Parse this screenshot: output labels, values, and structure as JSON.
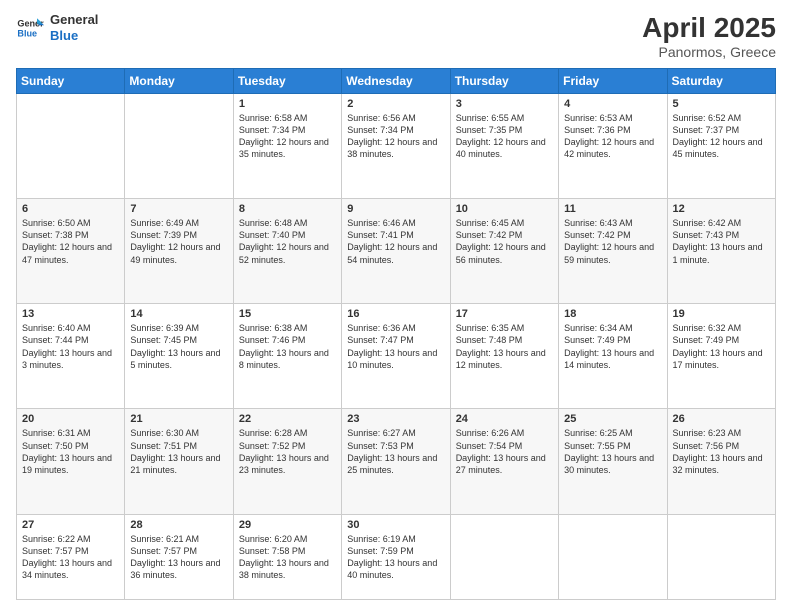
{
  "header": {
    "logo_line1": "General",
    "logo_line2": "Blue",
    "month_year": "April 2025",
    "location": "Panormos, Greece"
  },
  "weekdays": [
    "Sunday",
    "Monday",
    "Tuesday",
    "Wednesday",
    "Thursday",
    "Friday",
    "Saturday"
  ],
  "weeks": [
    [
      {
        "day": "",
        "sunrise": "",
        "sunset": "",
        "daylight": ""
      },
      {
        "day": "",
        "sunrise": "",
        "sunset": "",
        "daylight": ""
      },
      {
        "day": "1",
        "sunrise": "Sunrise: 6:58 AM",
        "sunset": "Sunset: 7:34 PM",
        "daylight": "Daylight: 12 hours and 35 minutes."
      },
      {
        "day": "2",
        "sunrise": "Sunrise: 6:56 AM",
        "sunset": "Sunset: 7:34 PM",
        "daylight": "Daylight: 12 hours and 38 minutes."
      },
      {
        "day": "3",
        "sunrise": "Sunrise: 6:55 AM",
        "sunset": "Sunset: 7:35 PM",
        "daylight": "Daylight: 12 hours and 40 minutes."
      },
      {
        "day": "4",
        "sunrise": "Sunrise: 6:53 AM",
        "sunset": "Sunset: 7:36 PM",
        "daylight": "Daylight: 12 hours and 42 minutes."
      },
      {
        "day": "5",
        "sunrise": "Sunrise: 6:52 AM",
        "sunset": "Sunset: 7:37 PM",
        "daylight": "Daylight: 12 hours and 45 minutes."
      }
    ],
    [
      {
        "day": "6",
        "sunrise": "Sunrise: 6:50 AM",
        "sunset": "Sunset: 7:38 PM",
        "daylight": "Daylight: 12 hours and 47 minutes."
      },
      {
        "day": "7",
        "sunrise": "Sunrise: 6:49 AM",
        "sunset": "Sunset: 7:39 PM",
        "daylight": "Daylight: 12 hours and 49 minutes."
      },
      {
        "day": "8",
        "sunrise": "Sunrise: 6:48 AM",
        "sunset": "Sunset: 7:40 PM",
        "daylight": "Daylight: 12 hours and 52 minutes."
      },
      {
        "day": "9",
        "sunrise": "Sunrise: 6:46 AM",
        "sunset": "Sunset: 7:41 PM",
        "daylight": "Daylight: 12 hours and 54 minutes."
      },
      {
        "day": "10",
        "sunrise": "Sunrise: 6:45 AM",
        "sunset": "Sunset: 7:42 PM",
        "daylight": "Daylight: 12 hours and 56 minutes."
      },
      {
        "day": "11",
        "sunrise": "Sunrise: 6:43 AM",
        "sunset": "Sunset: 7:42 PM",
        "daylight": "Daylight: 12 hours and 59 minutes."
      },
      {
        "day": "12",
        "sunrise": "Sunrise: 6:42 AM",
        "sunset": "Sunset: 7:43 PM",
        "daylight": "Daylight: 13 hours and 1 minute."
      }
    ],
    [
      {
        "day": "13",
        "sunrise": "Sunrise: 6:40 AM",
        "sunset": "Sunset: 7:44 PM",
        "daylight": "Daylight: 13 hours and 3 minutes."
      },
      {
        "day": "14",
        "sunrise": "Sunrise: 6:39 AM",
        "sunset": "Sunset: 7:45 PM",
        "daylight": "Daylight: 13 hours and 5 minutes."
      },
      {
        "day": "15",
        "sunrise": "Sunrise: 6:38 AM",
        "sunset": "Sunset: 7:46 PM",
        "daylight": "Daylight: 13 hours and 8 minutes."
      },
      {
        "day": "16",
        "sunrise": "Sunrise: 6:36 AM",
        "sunset": "Sunset: 7:47 PM",
        "daylight": "Daylight: 13 hours and 10 minutes."
      },
      {
        "day": "17",
        "sunrise": "Sunrise: 6:35 AM",
        "sunset": "Sunset: 7:48 PM",
        "daylight": "Daylight: 13 hours and 12 minutes."
      },
      {
        "day": "18",
        "sunrise": "Sunrise: 6:34 AM",
        "sunset": "Sunset: 7:49 PM",
        "daylight": "Daylight: 13 hours and 14 minutes."
      },
      {
        "day": "19",
        "sunrise": "Sunrise: 6:32 AM",
        "sunset": "Sunset: 7:49 PM",
        "daylight": "Daylight: 13 hours and 17 minutes."
      }
    ],
    [
      {
        "day": "20",
        "sunrise": "Sunrise: 6:31 AM",
        "sunset": "Sunset: 7:50 PM",
        "daylight": "Daylight: 13 hours and 19 minutes."
      },
      {
        "day": "21",
        "sunrise": "Sunrise: 6:30 AM",
        "sunset": "Sunset: 7:51 PM",
        "daylight": "Daylight: 13 hours and 21 minutes."
      },
      {
        "day": "22",
        "sunrise": "Sunrise: 6:28 AM",
        "sunset": "Sunset: 7:52 PM",
        "daylight": "Daylight: 13 hours and 23 minutes."
      },
      {
        "day": "23",
        "sunrise": "Sunrise: 6:27 AM",
        "sunset": "Sunset: 7:53 PM",
        "daylight": "Daylight: 13 hours and 25 minutes."
      },
      {
        "day": "24",
        "sunrise": "Sunrise: 6:26 AM",
        "sunset": "Sunset: 7:54 PM",
        "daylight": "Daylight: 13 hours and 27 minutes."
      },
      {
        "day": "25",
        "sunrise": "Sunrise: 6:25 AM",
        "sunset": "Sunset: 7:55 PM",
        "daylight": "Daylight: 13 hours and 30 minutes."
      },
      {
        "day": "26",
        "sunrise": "Sunrise: 6:23 AM",
        "sunset": "Sunset: 7:56 PM",
        "daylight": "Daylight: 13 hours and 32 minutes."
      }
    ],
    [
      {
        "day": "27",
        "sunrise": "Sunrise: 6:22 AM",
        "sunset": "Sunset: 7:57 PM",
        "daylight": "Daylight: 13 hours and 34 minutes."
      },
      {
        "day": "28",
        "sunrise": "Sunrise: 6:21 AM",
        "sunset": "Sunset: 7:57 PM",
        "daylight": "Daylight: 13 hours and 36 minutes."
      },
      {
        "day": "29",
        "sunrise": "Sunrise: 6:20 AM",
        "sunset": "Sunset: 7:58 PM",
        "daylight": "Daylight: 13 hours and 38 minutes."
      },
      {
        "day": "30",
        "sunrise": "Sunrise: 6:19 AM",
        "sunset": "Sunset: 7:59 PM",
        "daylight": "Daylight: 13 hours and 40 minutes."
      },
      {
        "day": "",
        "sunrise": "",
        "sunset": "",
        "daylight": ""
      },
      {
        "day": "",
        "sunrise": "",
        "sunset": "",
        "daylight": ""
      },
      {
        "day": "",
        "sunrise": "",
        "sunset": "",
        "daylight": ""
      }
    ]
  ]
}
